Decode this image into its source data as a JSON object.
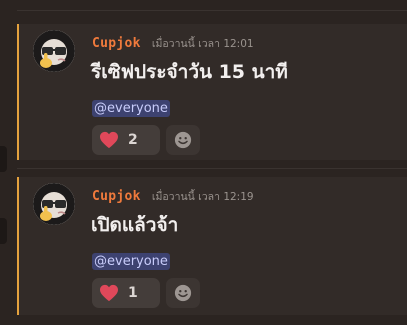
{
  "messages": [
    {
      "author": "Cupjok",
      "timestamp": "เมื่อวานนี้ เวลา 12:01",
      "content": "รีเซิฟประจำวัน 15 นาที",
      "mention": "@everyone",
      "reaction": {
        "emoji": "heart-icon",
        "count": "2"
      }
    },
    {
      "author": "Cupjok",
      "timestamp": "เมื่อวานนี้ เวลา 12:19",
      "content": "เปิดแล้วจ้า",
      "mention": "@everyone",
      "reaction": {
        "emoji": "heart-icon",
        "count": "1"
      }
    }
  ],
  "colors": {
    "background": "#2b2421",
    "message_background": "#322b28",
    "highlight_bar": "#e5a23e",
    "username": "#f07a3c",
    "mention_bg": "#3d4270",
    "mention_text": "#c9cdfb",
    "heart": "#e0485a"
  }
}
